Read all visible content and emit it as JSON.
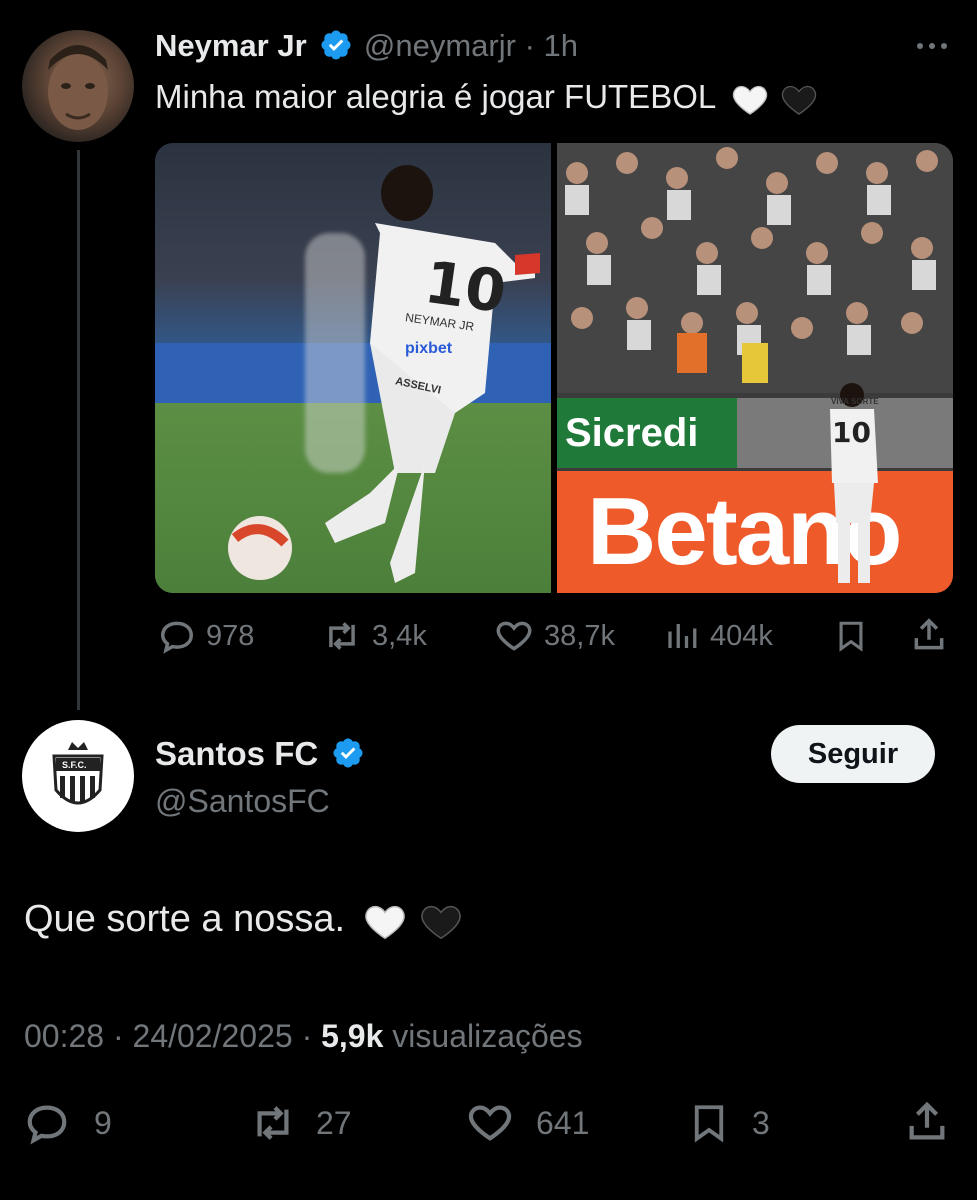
{
  "tweet1": {
    "name": "Neymar Jr",
    "handle": "@neymarjr",
    "sep": "·",
    "time": "1h",
    "text": "Minha maior alegria é jogar FUTEBOL",
    "image_left": {
      "number": "10",
      "name": "NEYMAR JR",
      "sponsor": "pixbet",
      "short_sponsor": "ASSELVI"
    },
    "image_right": {
      "banner_top": "Sicredi",
      "banner_bottom": "Betano",
      "number": "10",
      "shirt_top": "VIVA SORTE"
    },
    "stats": {
      "replies": "978",
      "retweets": "3,4k",
      "likes": "38,7k",
      "views": "404k"
    }
  },
  "tweet2": {
    "name": "Santos FC",
    "handle": "@SantosFC",
    "follow_label": "Seguir",
    "text": "Que sorte a nossa.",
    "time": "00:28",
    "dot1": "·",
    "date": "24/02/2025",
    "dot2": "·",
    "views_count": "5,9k",
    "views_label": "visualizações",
    "stats": {
      "replies": "9",
      "retweets": "27",
      "likes": "641",
      "bookmarks": "3"
    },
    "logo_text": "S.F.C."
  },
  "colors": {
    "background": "#000000",
    "text": "#e7e9ea",
    "muted": "#71767b",
    "verified": "#1d9bf0"
  }
}
